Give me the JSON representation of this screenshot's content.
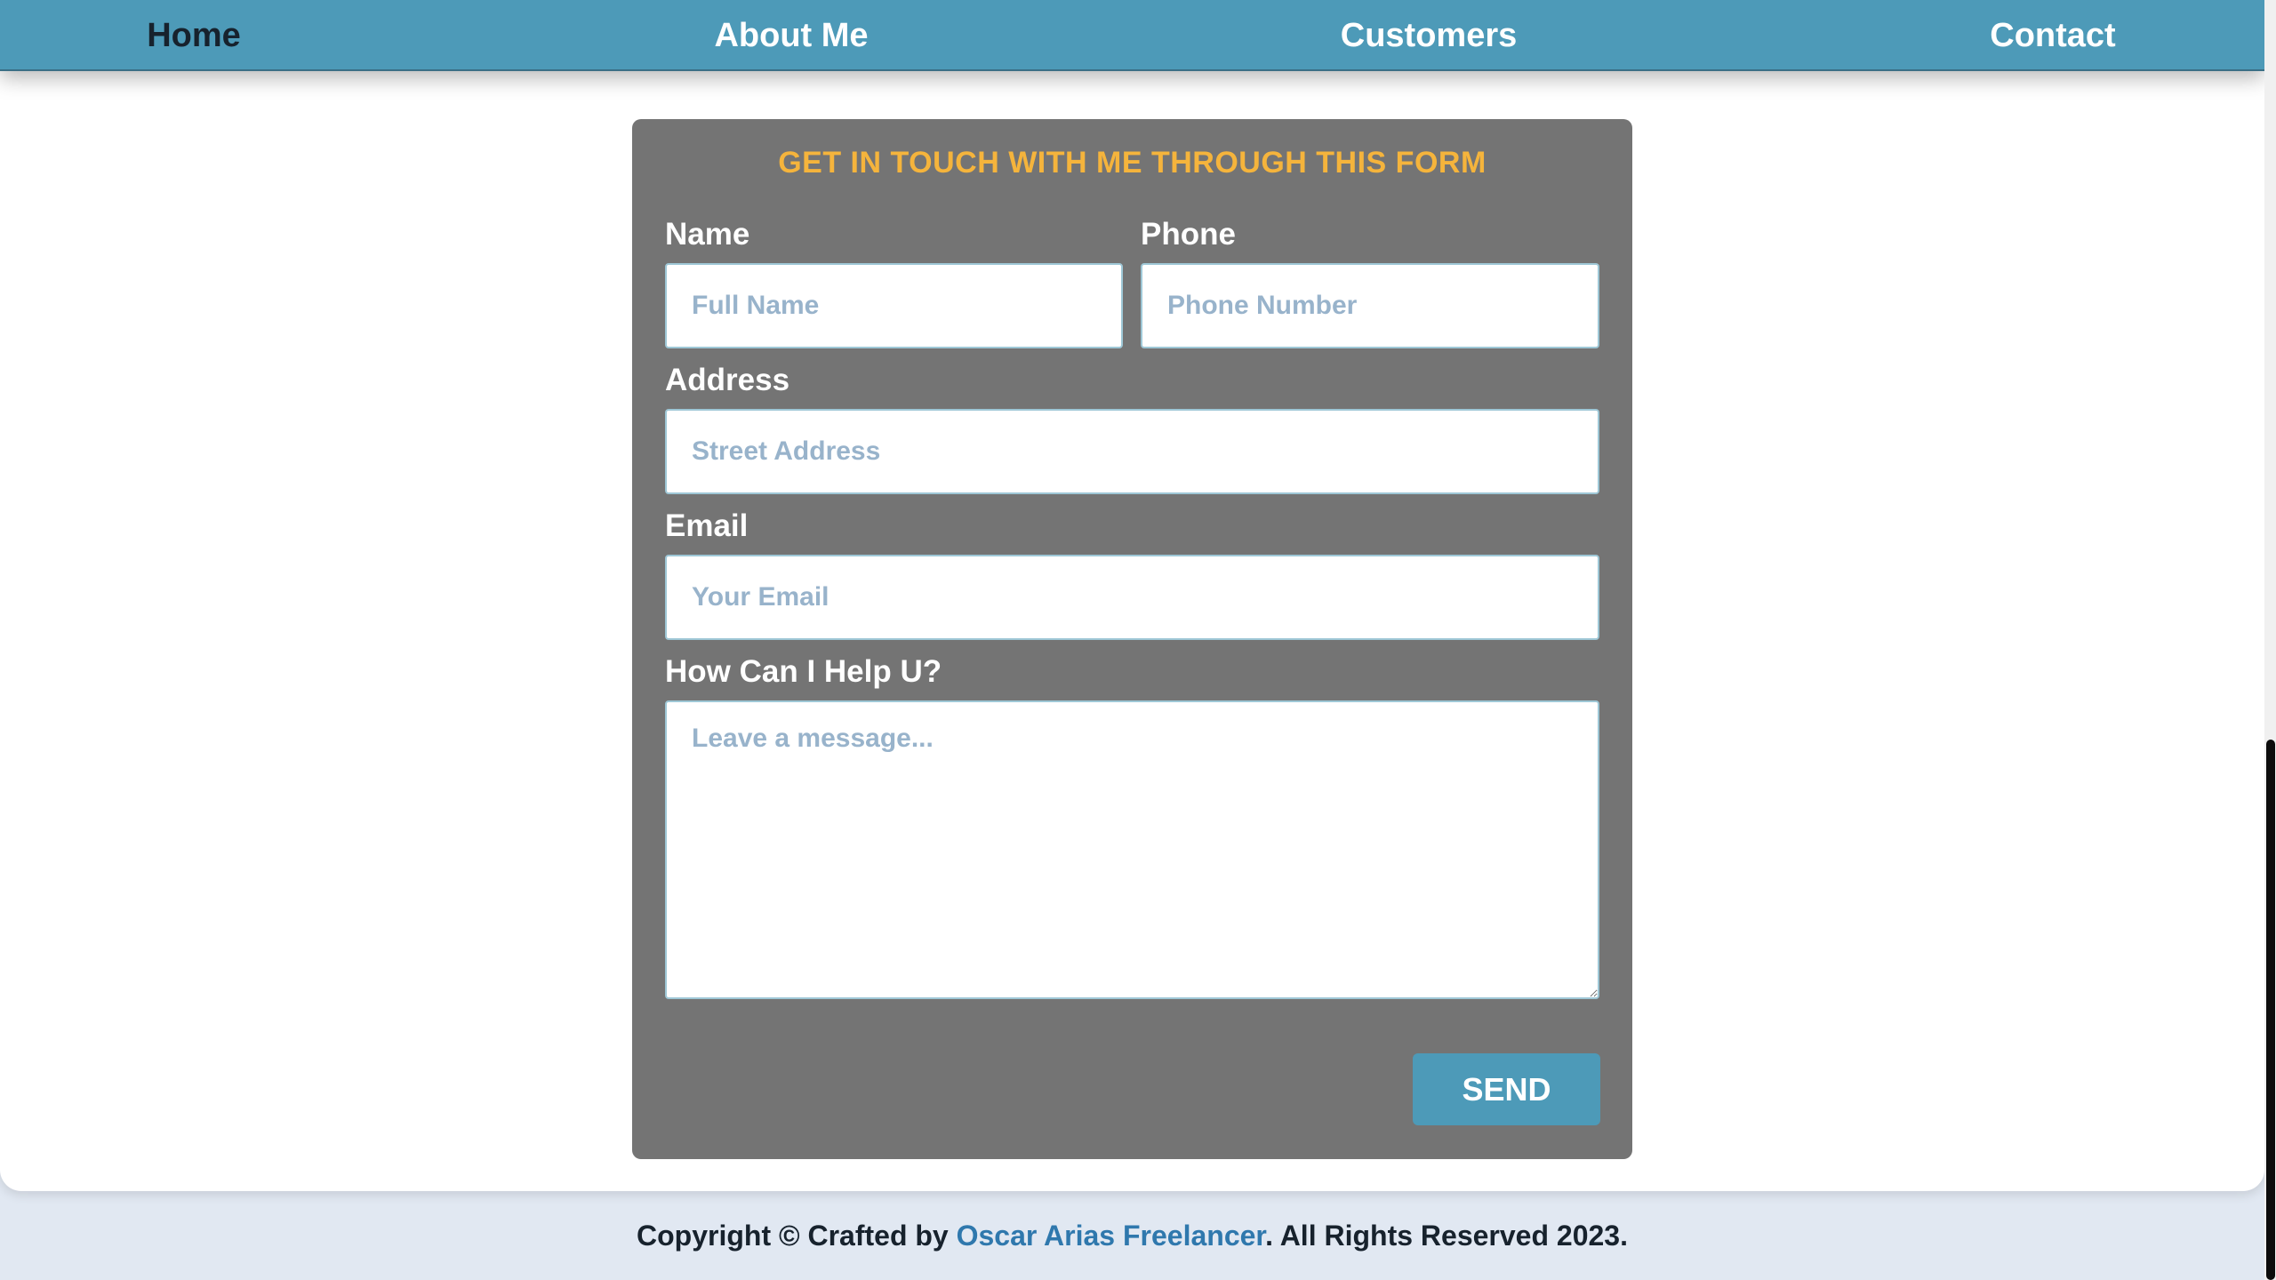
{
  "nav": {
    "items": [
      {
        "label": "Home",
        "active": true
      },
      {
        "label": "About Me",
        "active": false
      },
      {
        "label": "Customers",
        "active": false
      },
      {
        "label": "Contact",
        "active": false
      }
    ]
  },
  "form": {
    "title": "GET IN TOUCH WITH ME THROUGH THIS FORM",
    "name": {
      "label": "Name",
      "placeholder": "Full Name",
      "value": ""
    },
    "phone": {
      "label": "Phone",
      "placeholder": "Phone Number",
      "value": ""
    },
    "address": {
      "label": "Address",
      "placeholder": "Street Address",
      "value": ""
    },
    "email": {
      "label": "Email",
      "placeholder": "Your Email",
      "value": ""
    },
    "message": {
      "label": "How Can I Help U?",
      "placeholder": "Leave a message...",
      "value": ""
    },
    "send_label": "SEND"
  },
  "footer": {
    "prefix": "Copyright © Crafted by ",
    "link": "Oscar Arias Freelancer",
    "suffix": ". All Rights Reserved 2023."
  },
  "colors": {
    "nav_bg": "#4d9ab8",
    "card_bg": "#747474",
    "title": "#f5b43c",
    "footer_link": "#2f78ad",
    "page_bg": "#e1e8f2"
  }
}
